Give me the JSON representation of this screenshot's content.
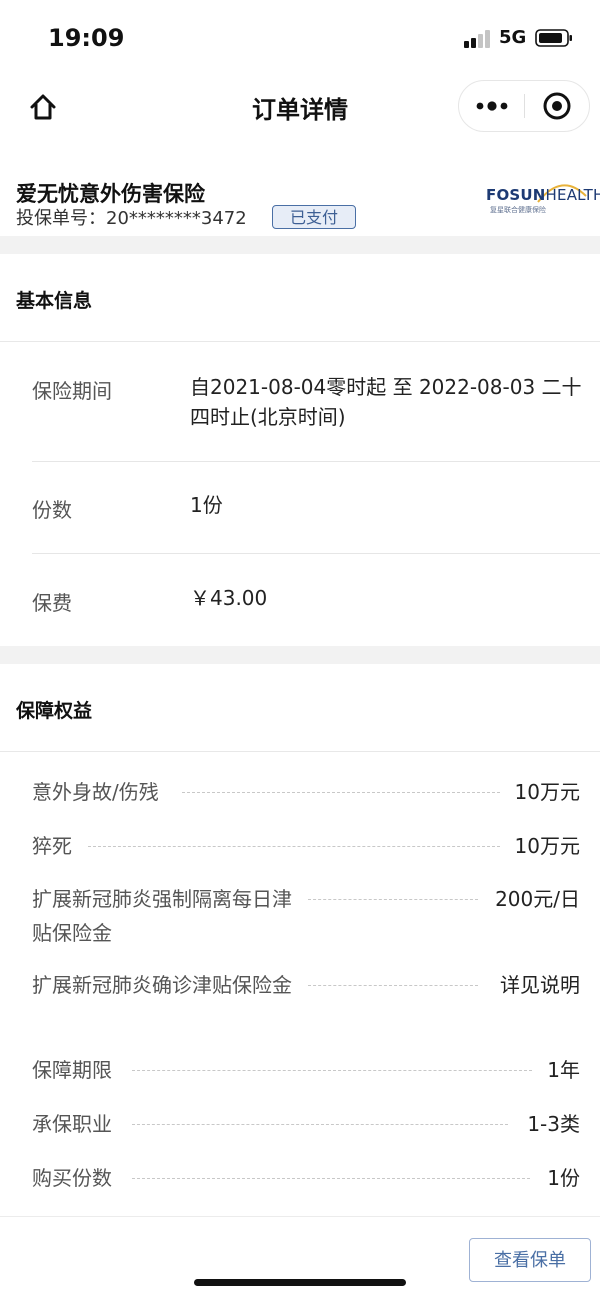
{
  "status_bar": {
    "time": "19:09",
    "network": "5G",
    "signal_icon": "signal-bars-icon",
    "battery_icon": "battery-icon"
  },
  "nav": {
    "title": "订单详情",
    "home_icon": "home-icon",
    "more_icon": "more-dots-icon",
    "close_icon": "target-circle-icon"
  },
  "product": {
    "name": "爱无忧意外伤害保险",
    "policy_no": "投保单号：20********3472",
    "status_badge": "已支付",
    "brand_logo": "FOSUN HEALTH",
    "brand_logo_sub": "复星联合健康保险"
  },
  "basic_info": {
    "title": "基本信息",
    "rows": [
      {
        "label": "保险期间",
        "value": "自2021-08-04零时起 至 2022-08-03 二十四时止(北京时间)"
      },
      {
        "label": "份数",
        "value": "1份"
      },
      {
        "label": "保费",
        "value": "￥43.00"
      }
    ]
  },
  "benefits": {
    "title": "保障权益",
    "rows": [
      {
        "label": "意外身故/伤残",
        "value": "10万元"
      },
      {
        "label": "猝死",
        "value": "10万元"
      },
      {
        "label": "扩展新冠肺炎强制隔离每日津贴保险金",
        "value": "200元/日"
      },
      {
        "label": "扩展新冠肺炎确诊津贴保险金",
        "value": "详见说明"
      },
      {
        "label": "保障期限",
        "value": "1年"
      },
      {
        "label": "承保职业",
        "value": "1-3类"
      },
      {
        "label": "购买份数",
        "value": "1份"
      }
    ]
  },
  "footer": {
    "view_policy_label": "查看保单"
  },
  "colors": {
    "accent": "#4a6fa5",
    "badge_bg": "#e7edf7",
    "gap_gray": "#f2f2f2",
    "logo_blue": "#1d3a73",
    "logo_gold": "#e8b23a"
  }
}
